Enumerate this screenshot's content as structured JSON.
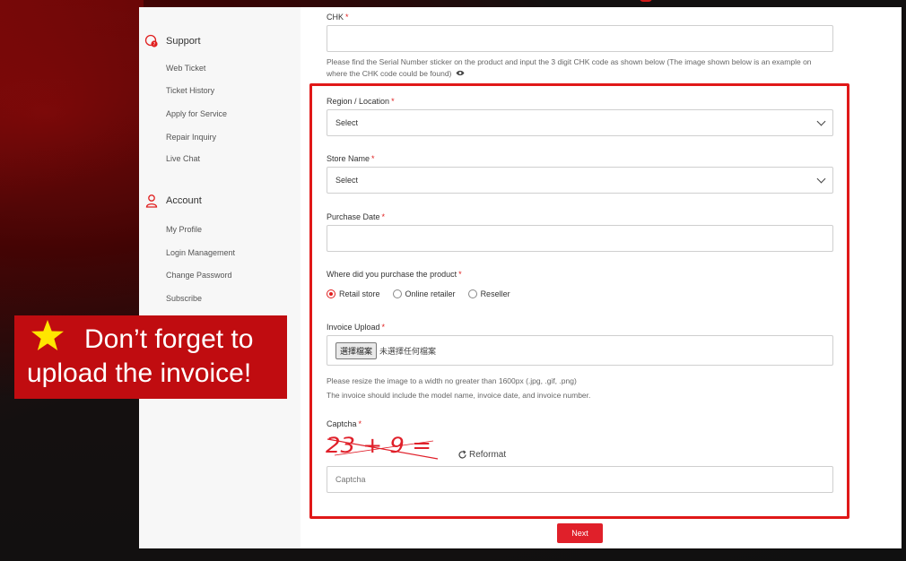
{
  "sidebar": {
    "support": {
      "heading": "Support",
      "items": [
        "Web Ticket",
        "Ticket History",
        "Apply for Service",
        "Repair Inquiry",
        "Live Chat"
      ]
    },
    "account": {
      "heading": "Account",
      "items": [
        "My Profile",
        "Login Management",
        "Change Password",
        "Subscribe"
      ]
    }
  },
  "form": {
    "required_mark": "*",
    "chk": {
      "label": "CHK",
      "value": "",
      "help": "Please find the Serial Number sticker on the product and input the 3 digit CHK code as shown below (The image shown below is an example on where the CHK code could be found)"
    },
    "region": {
      "label": "Region / Location",
      "selected": "Select"
    },
    "store": {
      "label": "Store Name",
      "selected": "Select"
    },
    "purchase_date": {
      "label": "Purchase Date",
      "value": ""
    },
    "purchase_place": {
      "label": "Where did you purchase the product",
      "options": [
        "Retail store",
        "Online retailer",
        "Reseller"
      ],
      "selected": "Retail store"
    },
    "invoice": {
      "label": "Invoice Upload",
      "button": "選擇檔案",
      "status": "未選擇任何檔案",
      "help1": "Please resize the image to a width no greater than 1600px (.jpg, .gif, .png)",
      "help2": "The invoice should include the model name, invoice date, and invoice number."
    },
    "captcha": {
      "label": "Captcha",
      "image_text": "23 + 9 =",
      "reformat": "Reformat",
      "placeholder": "Captcha"
    },
    "next": "Next"
  },
  "callout": {
    "line1": "Don’t forget to",
    "line2": "upload the invoice!"
  },
  "colors": {
    "accent": "#e0202a",
    "highlight_border": "#e01818",
    "callout_bg": "#c00c10",
    "star": "#ffe600"
  }
}
